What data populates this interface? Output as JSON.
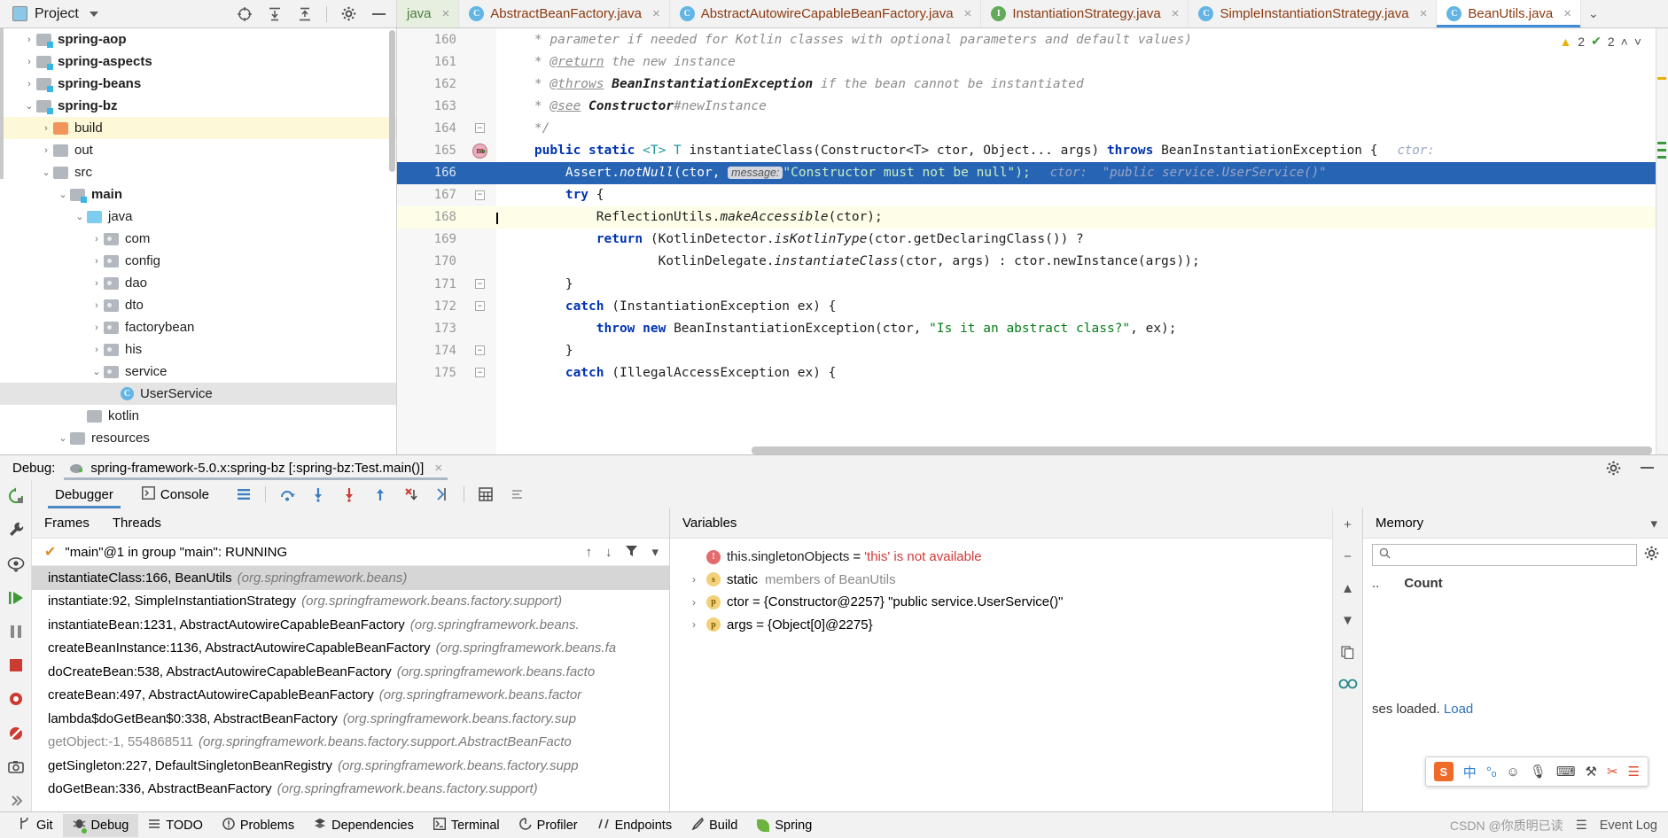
{
  "topbar": {
    "project_label": "Project",
    "project_icon": "project-window-icon",
    "tools": [
      "locate-icon",
      "expand-all-icon",
      "collapse-all-icon",
      "settings-gear-icon",
      "minimize-icon"
    ],
    "tabs": [
      {
        "label": "java",
        "icon": "java-module-icon",
        "type": "plain",
        "active": false
      },
      {
        "label": "AbstractBeanFactory.java",
        "icon": "class-icon",
        "type": "class",
        "active": false
      },
      {
        "label": "AbstractAutowireCapableBeanFactory.java",
        "icon": "class-icon",
        "type": "class",
        "active": false
      },
      {
        "label": "InstantiationStrategy.java",
        "icon": "interface-icon",
        "type": "interface",
        "active": false
      },
      {
        "label": "SimpleInstantiationStrategy.java",
        "icon": "class-icon",
        "type": "class",
        "active": false
      },
      {
        "label": "BeanUtils.java",
        "icon": "class-icon",
        "type": "class",
        "active": true
      }
    ],
    "tab_close_label": "×",
    "tabs_overflow_icon": "chevron-down-icon"
  },
  "tree": {
    "items": [
      {
        "label": "spring-aop",
        "indent": 1,
        "arrow": "›",
        "kind": "module",
        "bold": true,
        "sel": ""
      },
      {
        "label": "spring-aspects",
        "indent": 1,
        "arrow": "›",
        "kind": "module",
        "bold": true,
        "sel": ""
      },
      {
        "label": "spring-beans",
        "indent": 1,
        "arrow": "›",
        "kind": "module",
        "bold": true,
        "sel": ""
      },
      {
        "label": "spring-bz",
        "indent": 1,
        "arrow": "⌄",
        "kind": "module",
        "bold": true,
        "sel": ""
      },
      {
        "label": "build",
        "indent": 2,
        "arrow": "›",
        "kind": "build",
        "bold": false,
        "sel": "sel-y"
      },
      {
        "label": "out",
        "indent": 2,
        "arrow": "›",
        "kind": "folder",
        "bold": false,
        "sel": ""
      },
      {
        "label": "src",
        "indent": 2,
        "arrow": "⌄",
        "kind": "folder",
        "bold": false,
        "sel": ""
      },
      {
        "label": "main",
        "indent": 3,
        "arrow": "⌄",
        "kind": "module",
        "bold": true,
        "sel": ""
      },
      {
        "label": "java",
        "indent": 4,
        "arrow": "⌄",
        "kind": "src",
        "bold": false,
        "sel": ""
      },
      {
        "label": "com",
        "indent": 5,
        "arrow": "›",
        "kind": "pkg",
        "bold": false,
        "sel": ""
      },
      {
        "label": "config",
        "indent": 5,
        "arrow": "›",
        "kind": "pkg",
        "bold": false,
        "sel": ""
      },
      {
        "label": "dao",
        "indent": 5,
        "arrow": "›",
        "kind": "pkg",
        "bold": false,
        "sel": ""
      },
      {
        "label": "dto",
        "indent": 5,
        "arrow": "›",
        "kind": "pkg",
        "bold": false,
        "sel": ""
      },
      {
        "label": "factorybean",
        "indent": 5,
        "arrow": "›",
        "kind": "pkg",
        "bold": false,
        "sel": ""
      },
      {
        "label": "his",
        "indent": 5,
        "arrow": "›",
        "kind": "pkg",
        "bold": false,
        "sel": ""
      },
      {
        "label": "service",
        "indent": 5,
        "arrow": "⌄",
        "kind": "pkg",
        "bold": false,
        "sel": ""
      },
      {
        "label": "UserService",
        "indent": 6,
        "arrow": "",
        "kind": "class",
        "bold": false,
        "sel": "sel-g"
      },
      {
        "label": "kotlin",
        "indent": 4,
        "arrow": "",
        "kind": "folder",
        "bold": false,
        "sel": ""
      },
      {
        "label": "resources",
        "indent": 3,
        "arrow": "⌄",
        "kind": "folder",
        "bold": false,
        "sel": ""
      }
    ]
  },
  "editor": {
    "status": {
      "warning_count": "2",
      "ok_count": "2",
      "warning_icon": "warning-triangle-icon",
      "ok_icon": "checkmark-icon",
      "up_icon": "˄",
      "down_icon": "˅"
    },
    "lines": [
      {
        "n": "160",
        "state": "",
        "parts": [
          {
            "t": "    * parameter if needed for Kotlin classes with optional parameters and default values)",
            "c": "cmt"
          }
        ]
      },
      {
        "n": "161",
        "state": "",
        "parts": [
          {
            "t": "    * ",
            "c": "cmt"
          },
          {
            "t": "@return",
            "c": "tagl"
          },
          {
            "t": " the new instance",
            "c": "cmt"
          }
        ]
      },
      {
        "n": "162",
        "state": "",
        "parts": [
          {
            "t": "    * ",
            "c": "cmt"
          },
          {
            "t": "@throws",
            "c": "tagl"
          },
          {
            "t": " BeanInstantiationException",
            "c": "cmtb"
          },
          {
            "t": " if the bean cannot be instantiated",
            "c": "cmt"
          }
        ]
      },
      {
        "n": "163",
        "state": "",
        "parts": [
          {
            "t": "    * ",
            "c": "cmt"
          },
          {
            "t": "@see",
            "c": "tagl"
          },
          {
            "t": " Constructor",
            "c": "cmtb"
          },
          {
            "t": "#newInstance",
            "c": "cmt"
          }
        ]
      },
      {
        "n": "164",
        "state": "fold",
        "parts": [
          {
            "t": "    */",
            "c": "cmt"
          }
        ]
      },
      {
        "n": "165",
        "state": "bp",
        "parts": [
          {
            "t": "    ",
            "c": "pln"
          },
          {
            "t": "public static ",
            "c": "kw"
          },
          {
            "t": "<T> T ",
            "c": "typ"
          },
          {
            "t": "instantiateClass",
            "c": "pln"
          },
          {
            "t": "(Constructor<T> ctor, Object... args) ",
            "c": "pln"
          },
          {
            "t": "throws ",
            "c": "kw"
          },
          {
            "t": "BeanInstantiationException {",
            "c": "pln"
          }
        ]
      },
      {
        "n": "166",
        "state": "hl",
        "parts": [
          {
            "t": "        Assert.",
            "c": "pln"
          },
          {
            "t": "notNull",
            "c": "mth"
          },
          {
            "t": "(ctor, ",
            "c": "pln"
          },
          {
            "t": "__HINT__",
            "c": "hint"
          },
          {
            "t": "\"Constructor must not be null\");",
            "c": "str"
          }
        ]
      },
      {
        "n": "167",
        "state": "fold",
        "parts": [
          {
            "t": "        ",
            "c": "pln"
          },
          {
            "t": "try",
            "c": "kw"
          },
          {
            "t": " {",
            "c": "pln"
          }
        ]
      },
      {
        "n": "168",
        "state": "cur",
        "parts": [
          {
            "t": "            ReflectionUtils.",
            "c": "pln"
          },
          {
            "t": "makeAccessible",
            "c": "mth"
          },
          {
            "t": "(ctor);",
            "c": "pln"
          }
        ]
      },
      {
        "n": "169",
        "state": "",
        "parts": [
          {
            "t": "            ",
            "c": "pln"
          },
          {
            "t": "return",
            "c": "kw"
          },
          {
            "t": " (KotlinDetector.",
            "c": "pln"
          },
          {
            "t": "isKotlinType",
            "c": "mth"
          },
          {
            "t": "(ctor.getDeclaringClass()) ?",
            "c": "pln"
          }
        ]
      },
      {
        "n": "170",
        "state": "",
        "parts": [
          {
            "t": "                    KotlinDelegate.",
            "c": "pln"
          },
          {
            "t": "instantiateClass",
            "c": "mth"
          },
          {
            "t": "(ctor, args) : ctor.newInstance(args));",
            "c": "pln"
          }
        ]
      },
      {
        "n": "171",
        "state": "fold",
        "parts": [
          {
            "t": "        }",
            "c": "pln"
          }
        ]
      },
      {
        "n": "172",
        "state": "fold",
        "parts": [
          {
            "t": "        ",
            "c": "pln"
          },
          {
            "t": "catch",
            "c": "kw"
          },
          {
            "t": " (InstantiationException ex) {",
            "c": "pln"
          }
        ]
      },
      {
        "n": "173",
        "state": "",
        "parts": [
          {
            "t": "            ",
            "c": "pln"
          },
          {
            "t": "throw new",
            "c": "kw"
          },
          {
            "t": " BeanInstantiationException(ctor, ",
            "c": "pln"
          },
          {
            "t": "\"Is it an abstract class?\"",
            "c": "str"
          },
          {
            "t": ", ex);",
            "c": "pln"
          }
        ]
      },
      {
        "n": "174",
        "state": "fold",
        "parts": [
          {
            "t": "        }",
            "c": "pln"
          }
        ]
      },
      {
        "n": "175",
        "state": "fold",
        "parts": [
          {
            "t": "        ",
            "c": "pln"
          },
          {
            "t": "catch",
            "c": "kw"
          },
          {
            "t": " (IllegalAccessException ex) {",
            "c": "pln"
          }
        ]
      }
    ],
    "inline_hint_label": "message:",
    "line166_trailing_hint": "ctor:  \"public service.UserService()\"",
    "line165_trailing_hint": "ctor:"
  },
  "debug": {
    "title": "Debug:",
    "config_name": "spring-framework-5.0.x:spring-bz [:spring-bz:Test.main()]",
    "config_icon": "spring-boot-gradle-icon",
    "close_icon": "×",
    "head_right": [
      "settings-gear-icon",
      "minimize-icon"
    ],
    "tabs": [
      {
        "label": "Debugger",
        "icon": "",
        "active": true
      },
      {
        "label": "Console",
        "icon": "console-icon",
        "active": false
      }
    ],
    "toolbar_icons": [
      "layout-icon",
      "step-over-icon",
      "step-into-icon",
      "force-step-into-icon",
      "step-out-icon",
      "drop-frame-icon",
      "run-to-cursor-icon",
      "evaluate-expression-icon",
      "mute-breakpoints-icon"
    ],
    "left_rail_icons": [
      "rerun-icon",
      "wrench-settings-icon",
      "view-breakpoints-icon",
      "resume-program-icon",
      "pause-program-icon",
      "stop-icon",
      "camera-icon",
      "mute-breakpoints-rail-icon",
      "screenshot-icon",
      "expand-rail-icon"
    ],
    "frames": {
      "tab_frames": "Frames",
      "tab_threads": "Threads",
      "thread_label": "\"main\"@1 in group \"main\": RUNNING",
      "thread_icons": [
        "arrow-up-icon",
        "arrow-down-icon",
        "filter-icon",
        "dropdown-icon"
      ],
      "rows": [
        {
          "method": "instantiateClass:166, BeanUtils",
          "pkg": "(org.springframework.beans)",
          "sel": true
        },
        {
          "method": "instantiate:92, SimpleInstantiationStrategy",
          "pkg": "(org.springframework.beans.factory.support)",
          "sel": false
        },
        {
          "method": "instantiateBean:1231, AbstractAutowireCapableBeanFactory",
          "pkg": "(org.springframework.beans.",
          "sel": false
        },
        {
          "method": "createBeanInstance:1136, AbstractAutowireCapableBeanFactory",
          "pkg": "(org.springframework.beans.fa",
          "sel": false
        },
        {
          "method": "doCreateBean:538, AbstractAutowireCapableBeanFactory",
          "pkg": "(org.springframework.beans.facto",
          "sel": false
        },
        {
          "method": "createBean:497, AbstractAutowireCapableBeanFactory",
          "pkg": "(org.springframework.beans.factor",
          "sel": false
        },
        {
          "method": "lambda$doGetBean$0:338, AbstractBeanFactory",
          "pkg": "(org.springframework.beans.factory.sup",
          "sel": false
        },
        {
          "method": "getObject:-1, 554868511",
          "pkg": "(org.springframework.beans.factory.support.AbstractBeanFacto",
          "sel": false,
          "gray": true
        },
        {
          "method": "getSingleton:227, DefaultSingletonBeanRegistry",
          "pkg": "(org.springframework.beans.factory.supp",
          "sel": false
        },
        {
          "method": "doGetBean:336, AbstractBeanFactory",
          "pkg": "(org.springframework.beans.factory.support)",
          "sel": false
        }
      ]
    },
    "variables": {
      "title": "Variables",
      "rows": [
        {
          "expand": "",
          "badge": "!",
          "badge_kind": "err",
          "name": "this.singletonObjects",
          "eq": " = ",
          "value": "'this' is not available",
          "value_kind": "err"
        },
        {
          "expand": "›",
          "badge": "s",
          "badge_kind": "static",
          "name": "static",
          "eq": " ",
          "value": "members of BeanUtils",
          "value_kind": "gray"
        },
        {
          "expand": "›",
          "badge": "p",
          "badge_kind": "param",
          "name": "ctor",
          "eq": " = ",
          "value": "{Constructor@2257} \"public service.UserService()\"",
          "value_kind": "plain"
        },
        {
          "expand": "›",
          "badge": "p",
          "badge_kind": "param",
          "name": "args",
          "eq": " = ",
          "value": "{Object[0]@2275}",
          "value_kind": "plain"
        }
      ],
      "rail_icons": [
        "add-watch-icon",
        "remove-watch-icon",
        "collapse-icon",
        "scroll-up-icon",
        "scroll-down-icon",
        "copy-icon",
        "inspect-icon"
      ]
    },
    "memory": {
      "title": "Memory",
      "dropdown_icon": "chevron-down-icon",
      "search_placeholder": "",
      "search_icon": "search-icon",
      "settings_icon": "gear-icon",
      "col_class": "..",
      "col_count": "Count",
      "note_text": "ses loaded.",
      "note_link": "Load"
    }
  },
  "ime": {
    "logo": "S",
    "items": [
      "中",
      "°ₒ",
      "☺",
      "🎙",
      "⌨",
      "⚒",
      "✂",
      "☰"
    ]
  },
  "statusbar": {
    "items": [
      {
        "label": "Git",
        "icon": "git-branch-icon",
        "active": false
      },
      {
        "label": "Debug",
        "icon": "debug-bug-icon",
        "active": true
      },
      {
        "label": "TODO",
        "icon": "todo-list-icon",
        "active": false
      },
      {
        "label": "Problems",
        "icon": "problems-icon",
        "active": false
      },
      {
        "label": "Dependencies",
        "icon": "dependencies-icon",
        "active": false
      },
      {
        "label": "Terminal",
        "icon": "terminal-icon",
        "active": false
      },
      {
        "label": "Profiler",
        "icon": "profiler-icon",
        "active": false
      },
      {
        "label": "Endpoints",
        "icon": "endpoints-icon",
        "active": false
      },
      {
        "label": "Build",
        "icon": "build-hammer-icon",
        "active": false
      },
      {
        "label": "Spring",
        "icon": "spring-leaf-icon",
        "active": false
      }
    ],
    "watermark": "CSDN @你质明已读",
    "event_log": "Event Log",
    "event_log_icon": "event-log-icon"
  }
}
